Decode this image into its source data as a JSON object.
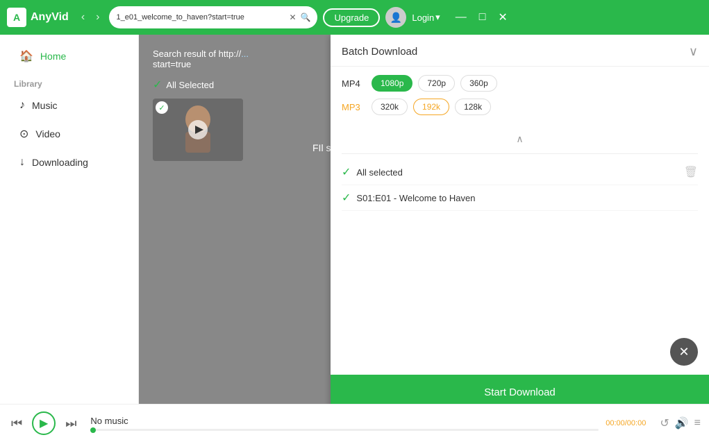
{
  "app": {
    "name": "AnyVid",
    "logo_letter": "A"
  },
  "titlebar": {
    "url": "1_e01_welcome_to_haven?start=true",
    "upgrade_label": "Upgrade",
    "login_label": "Login"
  },
  "sidebar": {
    "home_label": "Home",
    "library_heading": "Library",
    "music_label": "Music",
    "video_label": "Video",
    "downloading_label": "Downloading"
  },
  "content": {
    "search_result_prefix": "Search result of http://",
    "search_result_url": "start=true",
    "all_selected_label": "All Selected",
    "fil_selected_label": "FIl selected"
  },
  "batch_panel": {
    "title": "Batch Download",
    "mp4_label": "MP4",
    "mp3_label": "MP3",
    "resolutions": [
      "1080p",
      "720p",
      "360p"
    ],
    "bitrates": [
      "320k",
      "192k",
      "128k"
    ],
    "active_resolution": "1080p",
    "active_bitrate": "192k",
    "all_selected_label": "All selected",
    "items": [
      {
        "label": "S01:E01 - Welcome to Haven"
      }
    ],
    "start_download_label": "Start Download"
  },
  "player": {
    "no_music_label": "No music",
    "time_display": "00:00/00:00",
    "progress_percent": 0
  },
  "icons": {
    "back": "‹",
    "forward": "›",
    "search": "🔍",
    "clear": "✕",
    "collapse": "∨",
    "chevron_up": "∧",
    "delete": "🗑",
    "check": "✓",
    "play_triangle": "▶",
    "prev_track": "⏮",
    "next_track": "⏭",
    "repeat": "↺",
    "volume": "🔊",
    "playlist": "≡",
    "minimize": "—",
    "maximize": "□",
    "close": "✕"
  }
}
